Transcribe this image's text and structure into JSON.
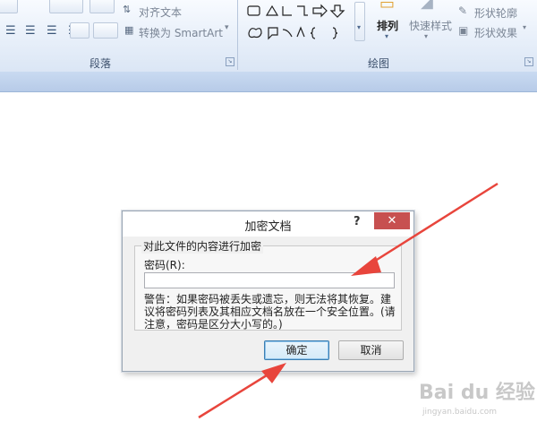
{
  "ribbon": {
    "align_text": "对齐文本",
    "convert_smartart": "转换为 SmartArt",
    "paragraph_group": "段落",
    "drawing_group": "绘图",
    "arrange": "排列",
    "quick_styles": "快速样式",
    "shape_outline": "形状轮廓",
    "shape_effects": "形状效果"
  },
  "dialog": {
    "title": "加密文档",
    "help": "?",
    "close": "✕",
    "group_legend": "对此文件的内容进行加密",
    "password_label": "密码(R):",
    "password_value": "",
    "warning": "警告：如果密码被丢失或遗忘，则无法将其恢复。建议将密码列表及其相应文档名放在一个安全位置。(请注意，密码是区分大小写的。)",
    "ok": "确定",
    "cancel": "取消"
  },
  "watermark": {
    "logo": "Bai du 经验",
    "url": "jingyan.baidu.com"
  },
  "colors": {
    "ribbon_bg": "#dfe9f5",
    "close_button": "#c75050",
    "arrow": "#e8453c"
  }
}
